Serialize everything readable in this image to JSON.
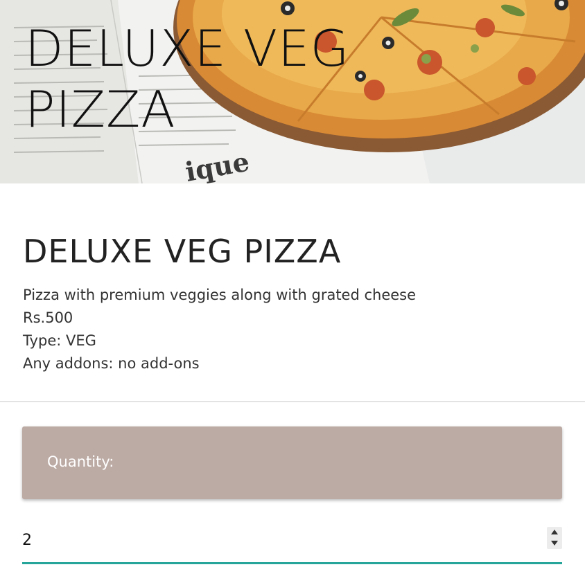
{
  "hero": {
    "title": "DELUXE VEG\nPIZZA"
  },
  "product": {
    "name": "DELUXE VEG PIZZA",
    "description": "Pizza with premium veggies along with grated cheese",
    "price": "Rs.500",
    "type_line": "Type: VEG",
    "addons_line": "Any addons: no add-ons"
  },
  "quantity": {
    "label": "Quantity:",
    "value": "2"
  },
  "colors": {
    "panel": "#bcaaa4",
    "input_underline": "#26a69a"
  },
  "icons": {
    "spin_up": "triangle-up-icon",
    "spin_down": "triangle-down-icon"
  }
}
